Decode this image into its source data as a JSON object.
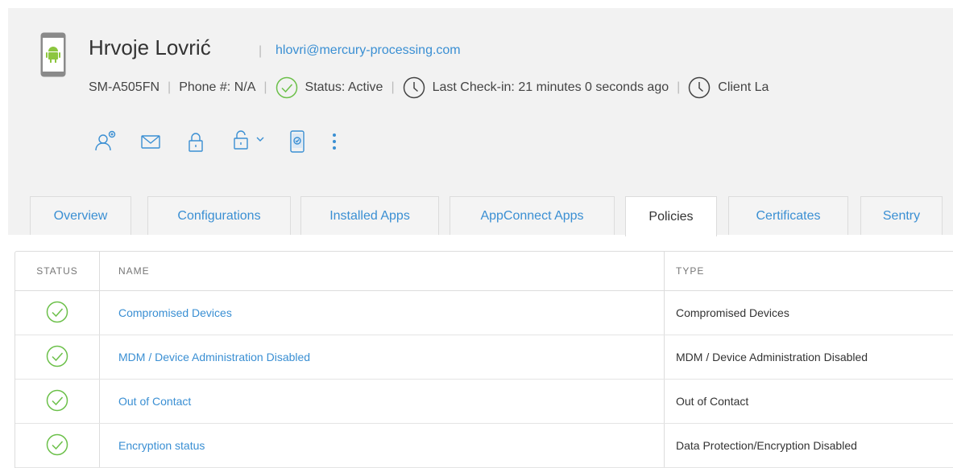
{
  "user": {
    "name": "Hrvoje Lovrić",
    "email": "hlovri@mercury-processing.com"
  },
  "device": {
    "model": "SM-A505FN",
    "phone": "Phone #: N/A",
    "status": "Status: Active",
    "last_checkin": "Last Check-in: 21 minutes 0 seconds ago",
    "client_last": "Client La"
  },
  "actions": [
    "add-user-icon",
    "mail-icon",
    "lock-icon",
    "unlock-icon",
    "chevron-down-icon",
    "device-check-icon",
    "more-icon"
  ],
  "tabs": [
    {
      "label": "Overview",
      "active": false
    },
    {
      "label": "Configurations",
      "active": false
    },
    {
      "label": "Installed Apps",
      "active": false
    },
    {
      "label": "AppConnect Apps",
      "active": false
    },
    {
      "label": "Policies",
      "active": true
    },
    {
      "label": "Certificates",
      "active": false
    },
    {
      "label": "Sentry",
      "active": false
    }
  ],
  "table": {
    "headers": {
      "status": "STATUS",
      "name": "NAME",
      "type": "TYPE"
    },
    "rows": [
      {
        "status": "ok",
        "name": "Compromised Devices",
        "type": "Compromised Devices"
      },
      {
        "status": "ok",
        "name": "MDM / Device Administration Disabled",
        "type": "MDM / Device Administration Disabled"
      },
      {
        "status": "ok",
        "name": "Out of Contact",
        "type": "Out of Contact"
      },
      {
        "status": "ok",
        "name": "Encryption status",
        "type": "Data Protection/Encryption Disabled"
      }
    ]
  },
  "colors": {
    "accent": "#3a8fd3",
    "status_ok": "#6cc04a",
    "android": "#8cc63f",
    "header_bg": "#f2f2f2"
  }
}
